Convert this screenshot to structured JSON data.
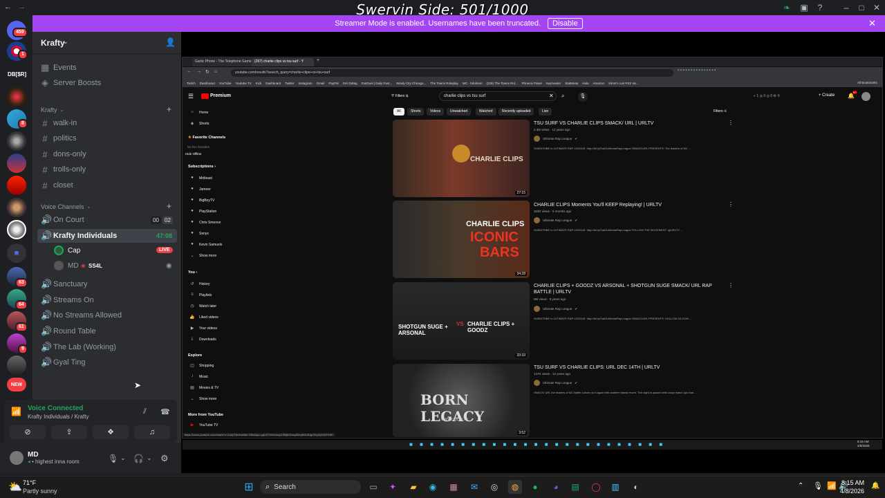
{
  "overlay": {
    "title": "Swervin Side: 501/1000"
  },
  "banner": {
    "text": "Streamer Mode is enabled. Usernames have been truncated.",
    "button": "Disable"
  },
  "rail": {
    "badge_1": "459",
    "badge_2": "1",
    "server_text": "DB[$R]",
    "badge_3": "8",
    "badge_4": "63",
    "badge_5": "64",
    "badge_6": "61",
    "badge_7": "9",
    "new_label": "NEW"
  },
  "guild": {
    "name": "Krafty"
  },
  "top_items": [
    {
      "label": "Events"
    },
    {
      "label": "Server Boosts"
    }
  ],
  "text_category": {
    "label": "Krafty"
  },
  "text_channels": [
    "walk-in",
    "politics",
    "dons-only",
    "trolls-only",
    "closet"
  ],
  "voice_category": {
    "label": "Voice Channels"
  },
  "voice_channels": {
    "on_court": {
      "label": "On Court",
      "count_a": "00",
      "count_b": "02"
    },
    "krafty_individuals": {
      "label": "Krafty Individuals",
      "time": "47:08"
    },
    "members": [
      {
        "name": "Cap",
        "badge": "LIVE"
      },
      {
        "name": "MD",
        "extra": "SS4L"
      }
    ],
    "rest": [
      "Sanctuary",
      "Streams On",
      "No Streams Allowed",
      "Round Table",
      "The Lab (Working)",
      "Gyal Ting"
    ]
  },
  "voice_panel": {
    "status": "Voice Connected",
    "location": "Krafty Individuals / Krafty"
  },
  "user_panel": {
    "name": "MD",
    "status": "highest inna room"
  },
  "browser": {
    "tabs": [
      "Gartic Phone - The Telephone Game",
      "(267) charlie clips vs tsu surf - Y"
    ],
    "url": "youtube.com/results?search_query=charlie+clips+vs+tsu+surf",
    "bookmarks": [
      "Twitch",
      "Dashboard",
      "YouTube",
      "Youtube TV",
      "Kick",
      "Dashboard",
      "Twitter",
      "Instagram",
      "Gmail",
      "PayPal",
      "Get Zoltag",
      "FanDuel | Daily Fant...",
      "Windy City Chicago...",
      "The Towns Roleplay",
      "WC - fufulmon",
      "(225) The Towns Rol...",
      "Phoenix Panel",
      "Keymaster",
      "StatMuse",
      "Hulu",
      "Amazon",
      "Vimm's Lair PS2 Va..."
    ],
    "all_bookmarks": "All Bookmarks",
    "status_url": "https://www.youtube.com/watch?v=1usj7Dezhw8&t=195s&pp=ygUZY2hhcmxpZSBjbGlwcyB2cyB0c3Ugc3VyZg%3D%3D"
  },
  "youtube": {
    "logo": "Premium",
    "filters_label": "Filters",
    "search_text": "charlie clips vs tsu surf",
    "create": "Create",
    "notif_count": "9+",
    "filters_right": "Filters",
    "chips": [
      "All",
      "Shorts",
      "Videos",
      "Unwatched",
      "Watched",
      "Recently uploaded",
      "Live"
    ],
    "side_main": [
      "Home",
      "Shorts"
    ],
    "fav_head": "Favorite Channels",
    "fav_note": "No live favorites",
    "hide_offline": "Hide Offline",
    "subs_head": "Subscriptions",
    "subs": [
      "Mrtlieast",
      "Jameer",
      "BigBoyTV",
      "PlayStation",
      "Chris Smoove",
      "Sonyx",
      "Kevin Samuels"
    ],
    "show_more": "Show more",
    "you_head": "You",
    "you_items": [
      "History",
      "Playlists",
      "Watch later",
      "Liked videos",
      "Your videos",
      "Downloads"
    ],
    "explore_head": "Explore",
    "explore_items": [
      "Shopping",
      "Music",
      "Movies & TV"
    ],
    "show_more_2": "Show more",
    "more_head": "More from YouTube",
    "more_items": [
      "YouTube TV"
    ],
    "videos": [
      {
        "title": "TSU SURF VS CHARLIE CLIPS SMACK/ URL | URLTV",
        "meta": "2.3M views · 12 years ago",
        "channel": "Ultimate Rap League",
        "desc": "SUBSCRIBE to ULTIMATE RAP LEAGUE: http://bit.ly/Sub2UltimateRapLeague SMACK/URL PRESENTS: The leaders of MC ...",
        "duration": "27:15",
        "thumb_text": "CHARLIE CLIPS"
      },
      {
        "title": "CHARLIE CLIPS Moments You'll KEEP Replaying! | URLTV",
        "meta": "303K views · 6 months ago",
        "channel": "Ultimate Rap League",
        "desc": "SUBSCRIBE to ULTIMATE RAP LEAGUE: http://bit.ly/Sub2UltimateRapLeague FOLLOW THE MOVEMENT: ig/URLTV ...",
        "duration": "34:28",
        "thumb_line1": "CHARLIE CLIPS",
        "thumb_line2": "ICONIC",
        "thumb_line3": "BARS"
      },
      {
        "title": "CHARLIE CLIPS + GOODZ VS ARSONAL + SHOTGUN SUGE SMACK/ URL RAP BATTLE | URLTV",
        "meta": "5M views · 8 years ago",
        "channel": "Ultimate Rap League",
        "desc": "SUBSCRIBE to ULTIMATE RAP LEAGUE: http://bit.ly/Sub2UltimateRapLeague SMACK/URL PRESENTS: HOLLOW DA DON ...",
        "duration": "33:33",
        "thumb_left": "SHOTGUN SUGE + ARSONAL",
        "thumb_right": "CHARLIE CLIPS + GOODZ"
      },
      {
        "title": "TSU SURF VS CHARLIE CLIPS: URL DEC 14TH | URLTV",
        "meta": "147K views · 12 years ago",
        "channel": "Ultimate Rap League",
        "desc": "SMACK/ URL the leaders of MC Battle culture do it again with another classic event. The night is packed with crazy match ups that ...",
        "duration": "3:52",
        "thumb_text": "BORN LEGACY",
        "thumb_sub": "WWW.URLTV.TV"
      }
    ]
  },
  "inner_clock": {
    "time": "8:15 AM",
    "date": "4/8/2026"
  },
  "taskbar": {
    "weather_temp": "71°F",
    "weather_desc": "Partly sunny",
    "search": "Search",
    "time": "8:15 AM",
    "date": "4/8/2026"
  },
  "colors": {
    "accent": "#a544f2",
    "discord_bg": "#2b2d31",
    "rail_bg": "#1e1f22",
    "green": "#23a55a",
    "live": "#f23f43",
    "yt_red": "#ff0000"
  }
}
